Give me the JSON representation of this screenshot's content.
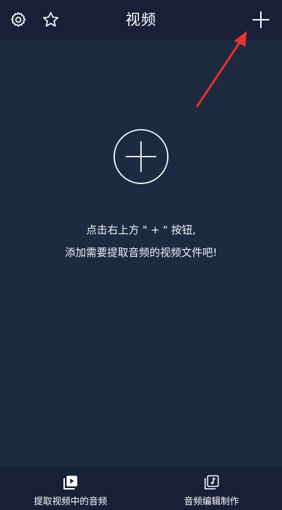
{
  "header": {
    "title": "视频",
    "left_icons": [
      "gear-icon",
      "star-icon"
    ],
    "right_icon": "plus-icon"
  },
  "empty_state": {
    "icon": "circle-plus-icon",
    "line1": "点击右上方 \" + \" 按钮,",
    "line2": "添加需要提取音频的视频文件吧!"
  },
  "annotation": {
    "arrow_color": "#e8352b"
  },
  "bottom_nav": {
    "items": [
      {
        "label": "提取视频中的音频",
        "icon": "video-play-icon"
      },
      {
        "label": "音频编辑制作",
        "icon": "music-note-icon"
      }
    ]
  },
  "colors": {
    "background": "#1e2a42",
    "bars": "#172037",
    "text": "#ffffff"
  }
}
